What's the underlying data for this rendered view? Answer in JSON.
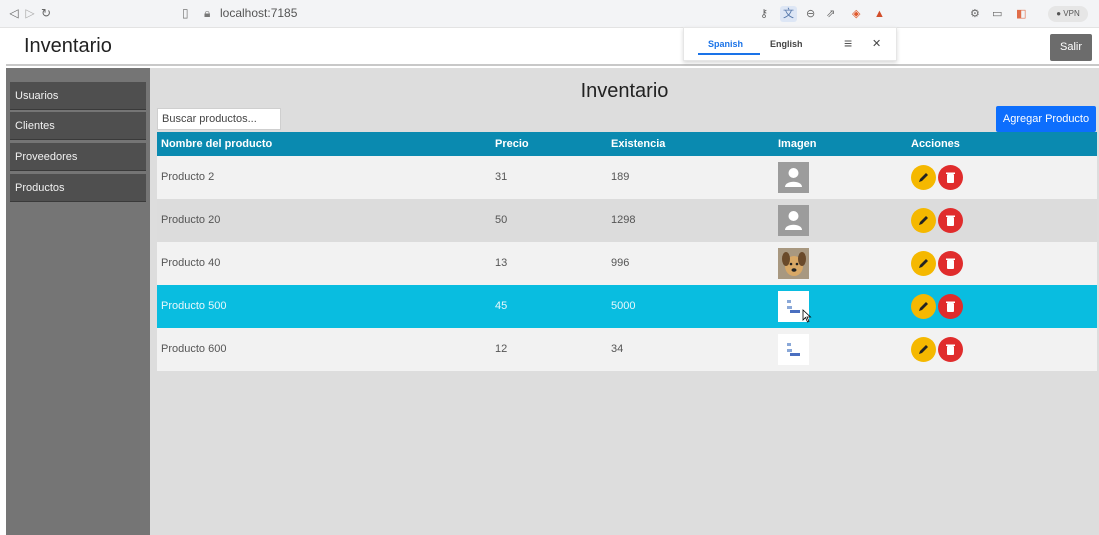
{
  "browser": {
    "url": "localhost:7185",
    "vpn_label": "VPN"
  },
  "app": {
    "title": "Inventario",
    "logout_label": "Salir"
  },
  "translate_popup": {
    "tab_spanish": "Spanish",
    "tab_english": "English"
  },
  "sidebar": {
    "items": [
      {
        "label": "Usuarios"
      },
      {
        "label": "Clientes"
      },
      {
        "label": "Proveedores"
      },
      {
        "label": "Productos"
      }
    ]
  },
  "main": {
    "title": "Inventario",
    "search_placeholder": "Buscar productos...",
    "add_button_label": "Agregar Producto",
    "table": {
      "headers": [
        "Nombre del producto",
        "Precio",
        "Existencia",
        "Imagen",
        "Acciones"
      ],
      "rows": [
        {
          "name": "Producto 2",
          "price": "31",
          "stock": "189",
          "image": "avatar-placeholder"
        },
        {
          "name": "Producto 20",
          "price": "50",
          "stock": "1298",
          "image": "avatar-placeholder"
        },
        {
          "name": "Producto 40",
          "price": "13",
          "stock": "996",
          "image": "dog-photo"
        },
        {
          "name": "Producto 500",
          "price": "45",
          "stock": "5000",
          "image": "document-thumbnail"
        },
        {
          "name": "Producto 600",
          "price": "12",
          "stock": "34",
          "image": "document-thumbnail"
        }
      ]
    }
  },
  "colors": {
    "header_bg": "#0a8ab0",
    "selected_row": "#09bde0",
    "edit_button": "#f5b800",
    "delete_button": "#e02c2c",
    "primary_button": "#0d6efd",
    "sidebar_bg": "#757575"
  }
}
